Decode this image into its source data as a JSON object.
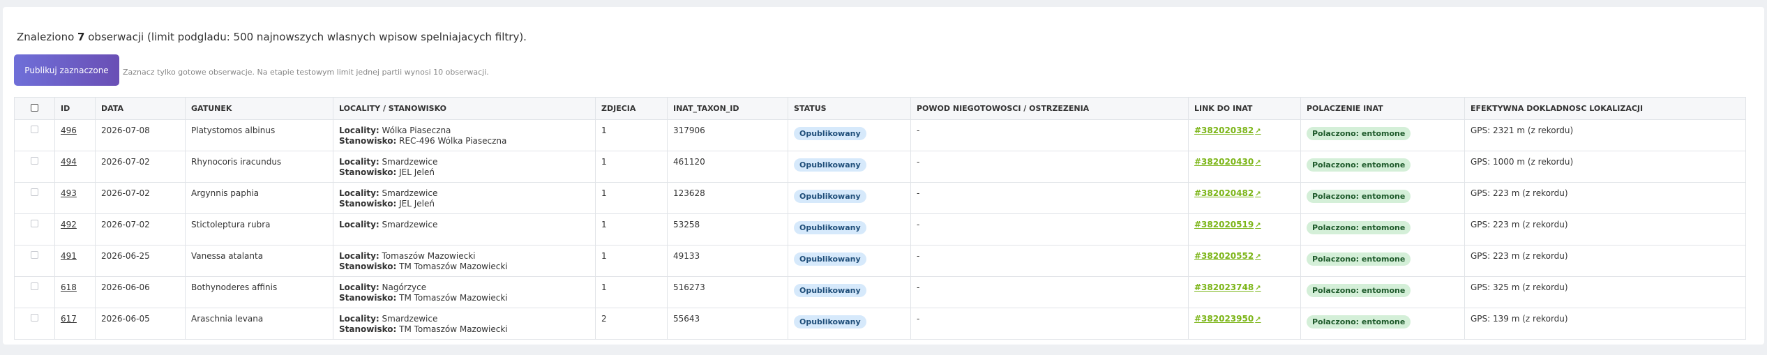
{
  "summary": {
    "prefix": "Znaleziono ",
    "count": "7",
    "suffix": " obserwacji (limit podgladu: 500 najnowszych wlasnych wpisow spelniajacych filtry)."
  },
  "publish": {
    "button_label": "Publikuj zaznaczone",
    "hint": "Zaznacz tylko gotowe obserwacje. Na etapie testowym limit jednej partii wynosi 10 obserwacji."
  },
  "table": {
    "headers": [
      "ID",
      "DATA",
      "GATUNEK",
      "LOCALITY / STANOWISKO",
      "ZDJECIA",
      "INAT_TAXON_ID",
      "STATUS",
      "POWOD NIEGOTOWOSCI / OSTRZEZENIA",
      "LINK DO INAT",
      "POLACZENIE INAT",
      "EFEKTYWNA DOKLADNOSC LOKALIZACJI"
    ],
    "locality_label": "Locality:",
    "stanowisko_label": "Stanowisko:",
    "rows": [
      {
        "id": "496",
        "date": "2026-07-08",
        "species": "Platystomos albinus",
        "locality": "Wólka Piaseczna",
        "stanowisko": "REC-496 Wólka Piaseczna",
        "photos": "1",
        "taxon_id": "317906",
        "status": "Opublikowany",
        "reason": "-",
        "inat_link": "#382020382",
        "connection": "Polaczono: entomone",
        "accuracy": "GPS: 2321 m (z rekordu)"
      },
      {
        "id": "494",
        "date": "2026-07-02",
        "species": "Rhynocoris iracundus",
        "locality": "Smardzewice",
        "stanowisko": "JEL Jeleń",
        "photos": "1",
        "taxon_id": "461120",
        "status": "Opublikowany",
        "reason": "-",
        "inat_link": "#382020430",
        "connection": "Polaczono: entomone",
        "accuracy": "GPS: 1000 m (z rekordu)"
      },
      {
        "id": "493",
        "date": "2026-07-02",
        "species": "Argynnis paphia",
        "locality": "Smardzewice",
        "stanowisko": "JEL Jeleń",
        "photos": "1",
        "taxon_id": "123628",
        "status": "Opublikowany",
        "reason": "-",
        "inat_link": "#382020482",
        "connection": "Polaczono: entomone",
        "accuracy": "GPS: 223 m (z rekordu)"
      },
      {
        "id": "492",
        "date": "2026-07-02",
        "species": "Stictoleptura rubra",
        "locality": "Smardzewice",
        "stanowisko": null,
        "photos": "1",
        "taxon_id": "53258",
        "status": "Opublikowany",
        "reason": "-",
        "inat_link": "#382020519",
        "connection": "Polaczono: entomone",
        "accuracy": "GPS: 223 m (z rekordu)"
      },
      {
        "id": "491",
        "date": "2026-06-25",
        "species": "Vanessa atalanta",
        "locality": "Tomaszów Mazowiecki",
        "stanowisko": "TM Tomaszów Mazowiecki",
        "photos": "1",
        "taxon_id": "49133",
        "status": "Opublikowany",
        "reason": "-",
        "inat_link": "#382020552",
        "connection": "Polaczono: entomone",
        "accuracy": "GPS: 223 m (z rekordu)"
      },
      {
        "id": "618",
        "date": "2026-06-06",
        "species": "Bothynoderes affinis",
        "locality": "Nagórzyce",
        "stanowisko": "TM Tomaszów Mazowiecki",
        "photos": "1",
        "taxon_id": "516273",
        "status": "Opublikowany",
        "reason": "-",
        "inat_link": "#382023748",
        "connection": "Polaczono: entomone",
        "accuracy": "GPS: 325 m (z rekordu)"
      },
      {
        "id": "617",
        "date": "2026-06-05",
        "species": "Araschnia levana",
        "locality": "Smardzewice",
        "stanowisko": "TM Tomaszów Mazowiecki",
        "photos": "2",
        "taxon_id": "55643",
        "status": "Opublikowany",
        "reason": "-",
        "inat_link": "#382023950",
        "connection": "Polaczono: entomone",
        "accuracy": "GPS: 139 m (z rekordu)"
      }
    ]
  },
  "icons": {
    "external_link": "external-link-icon"
  },
  "colors": {
    "accent": "#6a5acd",
    "link_green": "#7cb518",
    "status_blue": "#d6e9fb",
    "connected_green": "#d4efd8"
  }
}
